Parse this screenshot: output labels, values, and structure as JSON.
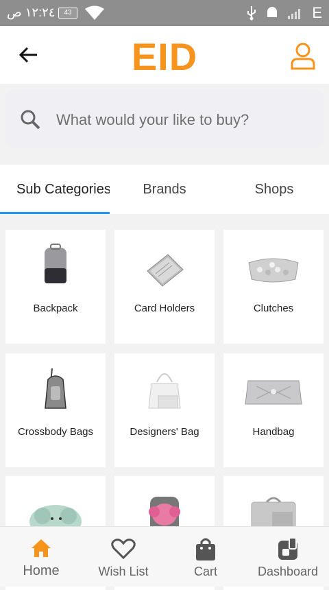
{
  "status_bar": {
    "time": "١٢:٢٤ ص",
    "battery": "43",
    "network": "E"
  },
  "app_bar": {
    "title": "EID"
  },
  "search": {
    "placeholder": "What would your like to buy?"
  },
  "tabs": [
    {
      "label": "Sub Categories"
    },
    {
      "label": "Brands"
    },
    {
      "label": "Shops"
    }
  ],
  "categories": [
    {
      "label": "Backpack"
    },
    {
      "label": "Card Holders"
    },
    {
      "label": "Clutches"
    },
    {
      "label": "Crossbody Bags"
    },
    {
      "label": "Designers' Bag"
    },
    {
      "label": "Handbag"
    }
  ],
  "bottom_nav": [
    {
      "label": "Home"
    },
    {
      "label": "Wish List"
    },
    {
      "label": "Cart"
    },
    {
      "label": "Dashboard"
    }
  ],
  "colors": {
    "accent": "#f7941d",
    "tab_indicator": "#2196f3"
  }
}
